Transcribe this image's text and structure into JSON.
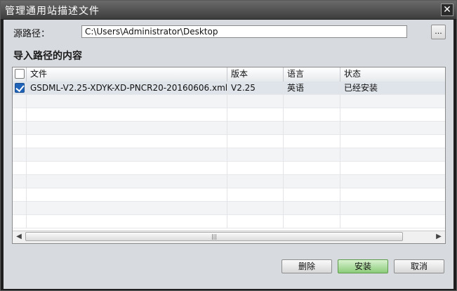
{
  "window": {
    "title": "管理通用站描述文件",
    "close_glyph": "✕"
  },
  "source": {
    "label": "源路径：",
    "value": "C:\\Users\\Administrator\\Desktop",
    "browse_label": "..."
  },
  "content": {
    "title": "导入路径的内容",
    "columns": [
      "文件",
      "版本",
      "语言",
      "状态"
    ],
    "rows": [
      {
        "checked": true,
        "file": "GSDML-V2.25-XDYK-XD-PNCR20-20160606.xml",
        "version": "V2.25",
        "language": "英语",
        "status": "已经安装"
      }
    ],
    "empty_rows": 10,
    "scrollbar": {
      "left_icon": "scroll-left-icon",
      "right_icon": "scroll-right-icon",
      "thumb_grip": "|||"
    }
  },
  "buttons": {
    "delete": "删除",
    "install": "安装",
    "cancel": "取消"
  },
  "colors": {
    "titlebar": "#4a4a4a",
    "client": "#d7dade",
    "primary_button": "#8ccc7a",
    "checkbox": "#1e63b8"
  }
}
